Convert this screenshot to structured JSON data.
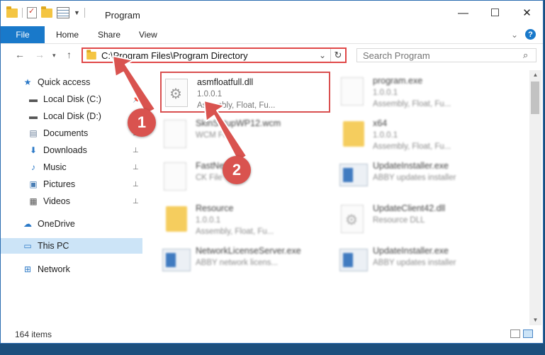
{
  "window": {
    "title": "Program"
  },
  "ribbon": {
    "tabs": [
      "File",
      "Home",
      "Share",
      "View"
    ]
  },
  "address": {
    "path": "C:\\Program Files\\Program Directory"
  },
  "search": {
    "placeholder": "Search Program"
  },
  "sidebar": {
    "items": [
      {
        "label": "Quick access",
        "icon": "star-icon"
      },
      {
        "label": "Local Disk (C:)",
        "icon": "drive-icon"
      },
      {
        "label": "Local Disk (D:)",
        "icon": "drive-icon"
      },
      {
        "label": "Documents",
        "icon": "documents-icon"
      },
      {
        "label": "Downloads",
        "icon": "download-icon"
      },
      {
        "label": "Music",
        "icon": "music-icon"
      },
      {
        "label": "Pictures",
        "icon": "pictures-icon"
      },
      {
        "label": "Videos",
        "icon": "videos-icon"
      },
      {
        "label": "OneDrive",
        "icon": "cloud-icon"
      },
      {
        "label": "This PC",
        "icon": "computer-icon"
      },
      {
        "label": "Network",
        "icon": "network-icon"
      }
    ]
  },
  "files": [
    {
      "name": "asmfloatfull.dll",
      "line2": "1.0.0.1",
      "line3": "Assembly, Float, Fu...",
      "icon": "dll-gear-icon"
    },
    {
      "name": "program.exe",
      "line2": "1.0.0.1",
      "line3": "Assembly, Float, Fu...",
      "icon": "exe-icon"
    },
    {
      "name": "SkinSetupWP12.wcm",
      "line2": "WCM File",
      "line3": "",
      "icon": "doc-icon"
    },
    {
      "name": "x64",
      "line2": "1.0.0.1",
      "line3": "Assembly, Float, Fu...",
      "icon": "folder-icon"
    },
    {
      "name": "FastNet",
      "line2": "CK File",
      "line3": "",
      "icon": "doc-icon"
    },
    {
      "name": "UpdateInstaller.exe",
      "line2": "ABBY updates installer",
      "line3": "",
      "icon": "installer-icon"
    },
    {
      "name": "Resource",
      "line2": "1.0.0.1",
      "line3": "Assembly, Float, Fu...",
      "icon": "folder-icon"
    },
    {
      "name": "UpdateClient42.dll",
      "line2": "Resource DLL",
      "line3": "",
      "icon": "dll-gear-icon"
    },
    {
      "name": "NetworkLicenseServer.exe",
      "line2": "ABBY network licens...",
      "line3": "",
      "icon": "installer-icon"
    },
    {
      "name": "UpdateInstaller.exe",
      "line2": "ABBY updates installer",
      "line3": "",
      "icon": "installer-icon"
    }
  ],
  "status": {
    "items_count": "164 items"
  },
  "callouts": {
    "step1": "1",
    "step2": "2"
  },
  "colors": {
    "accent": "#1979ca",
    "highlight": "#d94f4f"
  }
}
